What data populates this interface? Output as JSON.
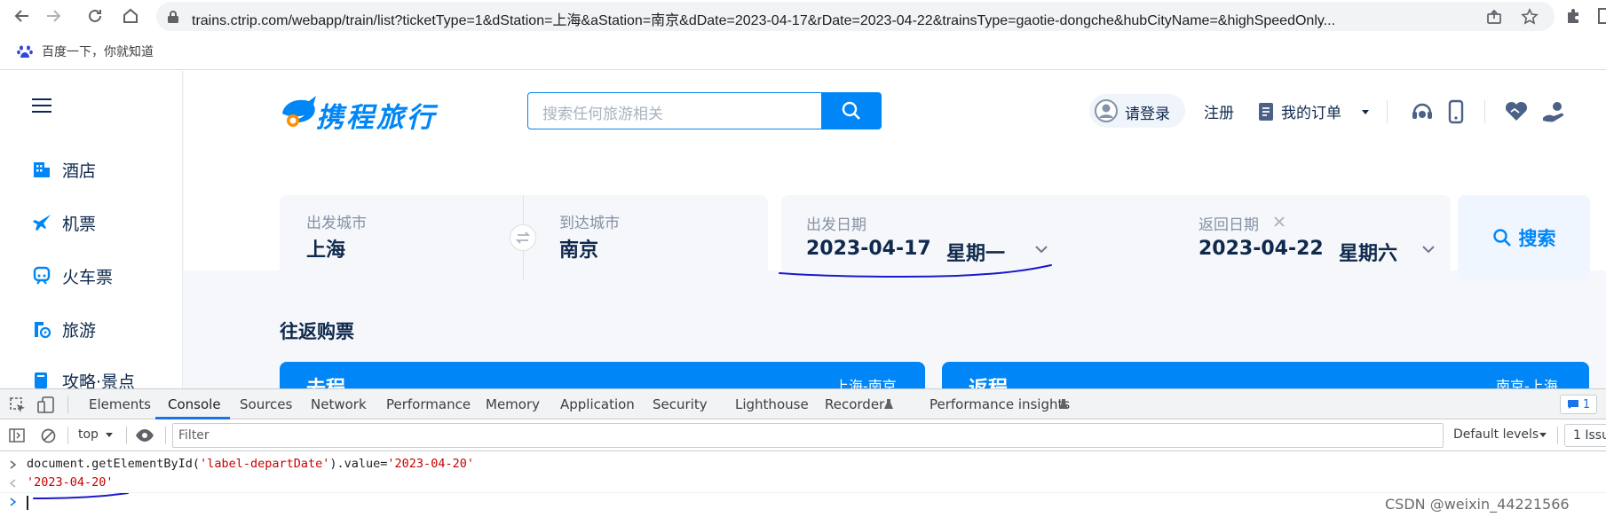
{
  "browser": {
    "url": "trains.ctrip.com/webapp/train/list?ticketType=1&dStation=上海&aStation=南京&dDate=2023-04-17&rDate=2023-04-22&trainsType=gaotie-dongche&hubCityName=&highSpeedOnly...",
    "bookmark": "百度一下，你就知道"
  },
  "sidebar": {
    "items": [
      {
        "label": "酒店",
        "icon": "hotel-icon"
      },
      {
        "label": "机票",
        "icon": "plane-icon"
      },
      {
        "label": "火车票",
        "icon": "train-icon"
      },
      {
        "label": "旅游",
        "icon": "travel-icon"
      },
      {
        "label": "攻略·景点",
        "icon": "guide-icon"
      }
    ]
  },
  "header": {
    "logo_text": "携程旅行",
    "search_placeholder": "搜索任何旅游相关",
    "login": "请登录",
    "register": "注册",
    "orders": "我的订单"
  },
  "form": {
    "depart_city_label": "出发城市",
    "depart_city": "上海",
    "arrive_city_label": "到达城市",
    "arrive_city": "南京",
    "depart_date_label": "出发日期",
    "depart_date": "2023-04-17",
    "depart_weekday": "星期一",
    "return_date_label": "返回日期",
    "return_date": "2023-04-22",
    "return_weekday": "星期六",
    "search_label": "搜索"
  },
  "section": {
    "title": "往返购票",
    "outbound": "去程",
    "outbound_route": "上海-南京",
    "return": "返程",
    "return_route": "南京-上海"
  },
  "devtools": {
    "tabs": [
      "Elements",
      "Console",
      "Sources",
      "Network",
      "Performance",
      "Memory",
      "Application",
      "Security",
      "Lighthouse",
      "Recorder",
      "Performance insights"
    ],
    "active_tab": "Console",
    "issues_badge": "1",
    "context": "top",
    "filter_placeholder": "Filter",
    "levels": "Default levels",
    "issues_btn": "1 Issu",
    "console_input": "document.getElementById('label-departDate').value='2023-04-20'",
    "console_output": "'2023-04-20'"
  },
  "watermark": "CSDN @weixin_44221566",
  "colors": {
    "accent": "#0086f6",
    "text": "#0f294d",
    "ink": "#1a1ac8"
  }
}
